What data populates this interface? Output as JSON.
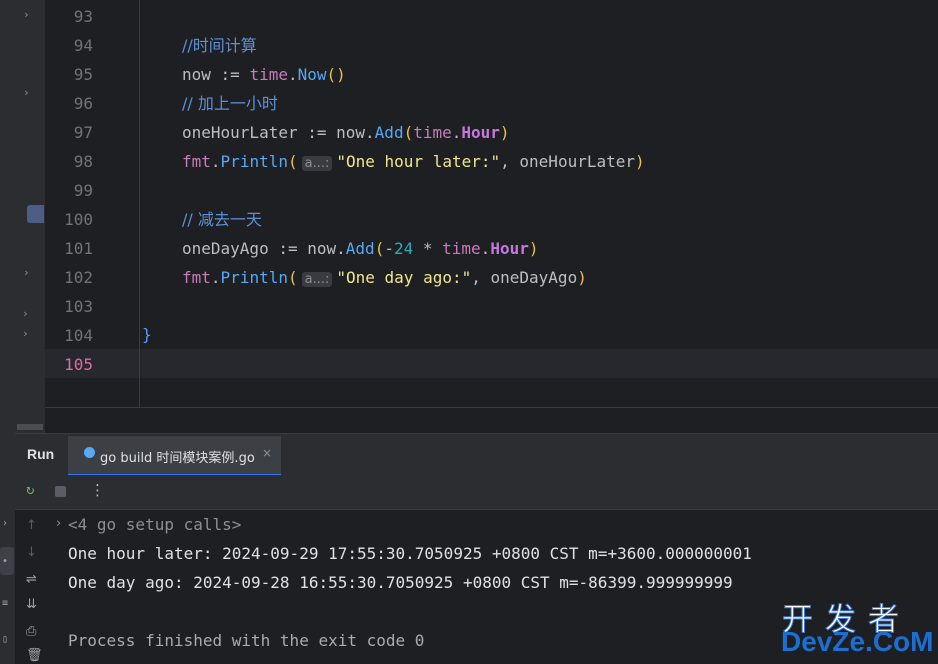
{
  "editor": {
    "lines": [
      {
        "num": "93"
      },
      {
        "num": "94",
        "comment": "//时间计算"
      },
      {
        "num": "95",
        "var": "now",
        "op": " := ",
        "pkg": "time",
        "dot": ".",
        "fn": "Now",
        "paren_open": "(",
        "paren_close": ")"
      },
      {
        "num": "96",
        "comment": "// 加上一小时"
      },
      {
        "num": "97",
        "var": "oneHourLater",
        "op": " := ",
        "recv": "now",
        "dot": ".",
        "fn": "Add",
        "paren_open": "(",
        "pkg": "time",
        "dot2": ".",
        "const": "Hour",
        "paren_close": ")"
      },
      {
        "num": "98",
        "pkg": "fmt",
        "dot": ".",
        "fn": "Println",
        "paren_open": "(",
        "hint": "a...:",
        "str": "\"One hour later:\"",
        "sep": ", ",
        "arg": "oneHourLater",
        "paren_close": ")"
      },
      {
        "num": "99"
      },
      {
        "num": "100",
        "comment": "// 减去一天"
      },
      {
        "num": "101",
        "var": "oneDayAgo",
        "op": " := ",
        "recv": "now",
        "dot": ".",
        "fn": "Add",
        "paren_open": "(",
        "minus": "-",
        "number": "24",
        "mul": " * ",
        "pkg": "time",
        "dot2": ".",
        "const": "Hour",
        "paren_close": ")"
      },
      {
        "num": "102",
        "pkg": "fmt",
        "dot": ".",
        "fn": "Println",
        "paren_open": "(",
        "hint": "a...:",
        "str": "\"One day ago:\"",
        "sep": ", ",
        "arg": "oneDayAgo",
        "paren_close": ")"
      },
      {
        "num": "103"
      },
      {
        "num": "104",
        "brace": "}"
      },
      {
        "num": "105"
      }
    ]
  },
  "run_panel": {
    "title": "Run",
    "tab_label": "go build 时间模块案例.go",
    "tab_close": "×",
    "more": "⋮",
    "output": {
      "fold": "<4 go setup calls>",
      "line1": "One hour later: 2024-09-29 17:55:30.7050925 +0800 CST m=+3600.000000001",
      "line2": "One day ago: 2024-09-28 16:55:30.7050925 +0800 CST m=-86399.999999999",
      "line3": "",
      "line4": "Process finished with the exit code 0"
    }
  },
  "watermark": {
    "top": "开发者",
    "bottom": "DevZe.CoM"
  },
  "colors": {
    "comment": "#5f8fd6",
    "function": "#57a8f5",
    "package": "#c77dbb",
    "string": "#f0e68c",
    "number": "#2aacb8",
    "accent": "#3574f0"
  }
}
